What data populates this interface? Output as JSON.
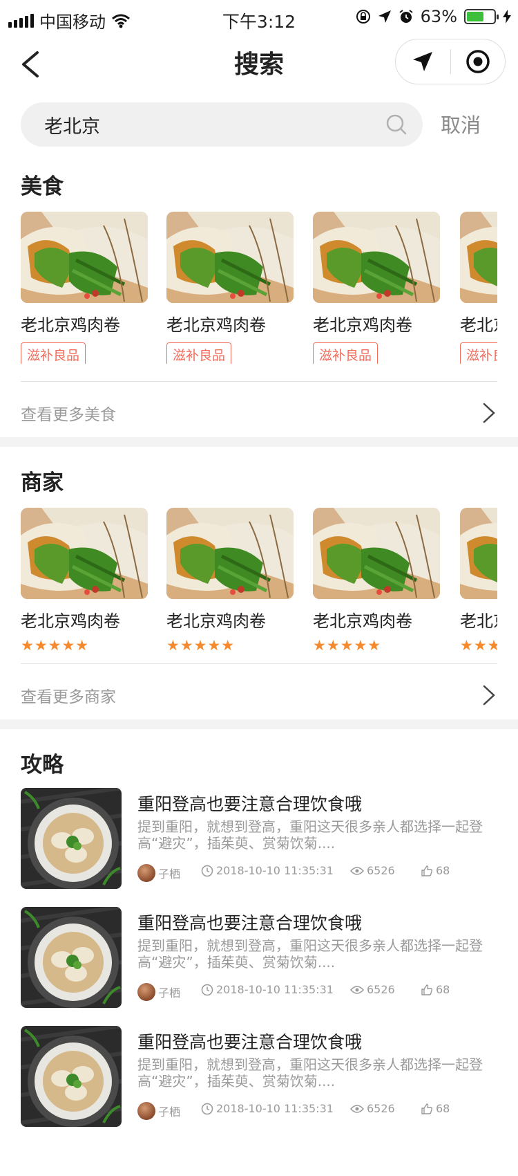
{
  "status_bar": {
    "carrier": "中国移动",
    "time": "下午3:12",
    "battery": "63%",
    "battery_level": 0.63
  },
  "nav": {
    "title": "搜索"
  },
  "search": {
    "value": "老北京",
    "cancel": "取消"
  },
  "food": {
    "title": "美食",
    "items": [
      {
        "name": "老北京鸡肉卷",
        "tag": "滋补良品"
      },
      {
        "name": "老北京鸡肉卷",
        "tag": "滋补良品"
      },
      {
        "name": "老北京鸡肉卷",
        "tag": "滋补良品"
      },
      {
        "name": "老北京鸡肉卷",
        "tag": "滋补良品"
      }
    ],
    "more": "查看更多美食"
  },
  "merchants": {
    "title": "商家",
    "items": [
      {
        "name": "老北京鸡肉卷",
        "stars": "★★★★★",
        "rating": 5
      },
      {
        "name": "老北京鸡肉卷",
        "stars": "★★★★★",
        "rating": 5
      },
      {
        "name": "老北京鸡肉卷",
        "stars": "★★★★★",
        "rating": 5
      },
      {
        "name": "老北京鸡肉卷",
        "stars": "★★★★★",
        "rating": 5
      }
    ],
    "more": "查看更多商家"
  },
  "guides": {
    "title": "攻略",
    "items": [
      {
        "title": "重阳登高也要注意合理饮食哦",
        "summary": "提到重阳，就想到登高，重阳这天很多亲人都选择一起登高“避灾”，插茱萸、赏菊饮菊....",
        "author": "子栖",
        "date": "2018-10-10 11:35:31",
        "views": "6526",
        "likes": "68"
      },
      {
        "title": "重阳登高也要注意合理饮食哦",
        "summary": "提到重阳，就想到登高，重阳这天很多亲人都选择一起登高“避灾”，插茱萸、赏菊饮菊....",
        "author": "子栖",
        "date": "2018-10-10 11:35:31",
        "views": "6526",
        "likes": "68"
      },
      {
        "title": "重阳登高也要注意合理饮食哦",
        "summary": "提到重阳，就想到登高，重阳这天很多亲人都选择一起登高“避灾”，插茱萸、赏菊饮菊....",
        "author": "子栖",
        "date": "2018-10-10 11:35:31",
        "views": "6526",
        "likes": "68"
      }
    ]
  },
  "colors": {
    "tag_red": "#f36b5b",
    "star_orange": "#f5892b",
    "battery_green": "#3cc03c"
  }
}
